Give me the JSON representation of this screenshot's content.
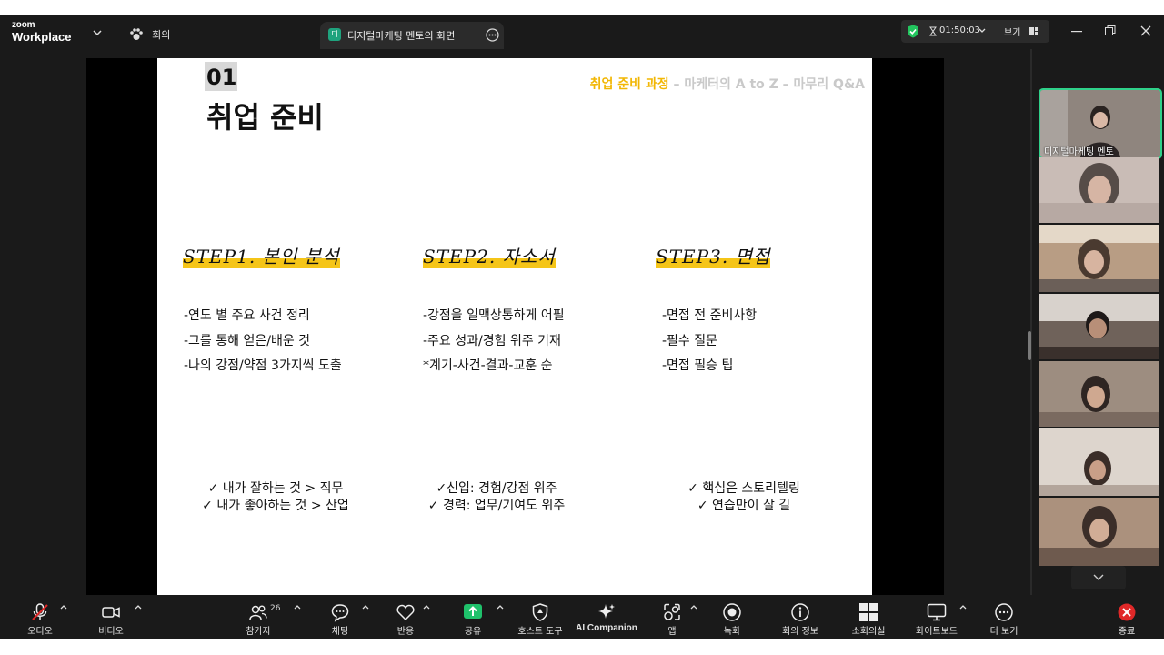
{
  "app": {
    "logo_line1": "zoom",
    "logo_line2": "Workplace"
  },
  "topbar": {
    "meeting_label": "회의",
    "tab_badge": "디",
    "tab_title": "디지털마케팅 멘토의 화면",
    "timer": "01:50:03",
    "view_label": "보기"
  },
  "slide": {
    "number": "01",
    "title": "취업 준비",
    "breadcrumb_active": "취업 준비 과정",
    "breadcrumb_rest": " – 마케터의 A to Z – 마무리 Q&A",
    "columns": [
      {
        "step": "STEP1. 본인 분석",
        "items": [
          "-연도 별 주요 사건 정리",
          "-그를 통해 얻은/배운 것",
          "-나의 강점/약점 3가지씩 도출"
        ],
        "checks": [
          "✓ 내가 잘하는 것 > 직무",
          "✓ 내가 좋아하는 것 > 산업"
        ]
      },
      {
        "step": "STEP2. 자소서",
        "items": [
          "-강점을 일맥상통하게 어필",
          "-주요 성과/경험 위주 기재",
          "*계기-사건-결과-교훈 순"
        ],
        "checks": [
          "✓신입: 경험/강점 위주",
          "✓ 경력: 업무/기여도 위주"
        ]
      },
      {
        "step": "STEP3. 면접",
        "items": [
          "-면접 전 준비사항",
          "-필수 질문",
          "-면접 필승 팁"
        ],
        "checks": [
          "✓ 핵심은 스토리텔링",
          "✓ 연습만이 살 길"
        ]
      }
    ]
  },
  "participants": {
    "host_name": "디지털마케팅 멘토"
  },
  "toolbar": {
    "audio": "오디오",
    "video": "비디오",
    "participants": "참가자",
    "participant_count": "26",
    "chat": "채팅",
    "reactions": "반응",
    "share": "공유",
    "host_tools": "호스트 도구",
    "ai_companion": "AI Companion",
    "apps": "앱",
    "record": "녹화",
    "meeting_info": "회의 정보",
    "breakout": "소회의실",
    "whiteboard": "화이트보드",
    "more": "더 보기",
    "end": "종료"
  },
  "colors": {
    "accent_green": "#1fa37e",
    "highlight_yellow": "#f5c518",
    "end_red": "#e02828",
    "thumb_border": "#2fd18a"
  }
}
